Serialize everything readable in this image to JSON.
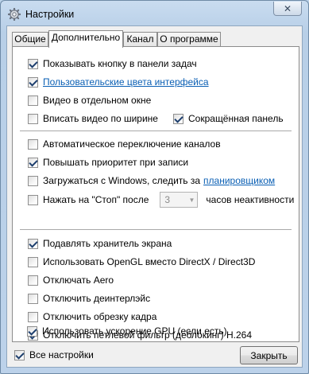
{
  "window": {
    "title": "Настройки",
    "close_glyph": "✕"
  },
  "tabs": [
    {
      "label": "Общие",
      "active": false
    },
    {
      "label": "Дополнительно",
      "active": true
    },
    {
      "label": "Канал",
      "active": false
    },
    {
      "label": "О программе",
      "active": false
    }
  ],
  "options": {
    "show_taskbar_button": {
      "label": "Показывать кнопку в панели задач",
      "checked": true
    },
    "custom_colors": {
      "label": "Пользовательские цвета интерфейса",
      "checked": true
    },
    "video_separate_window": {
      "label": "Видео в отдельном окне",
      "checked": false
    },
    "fit_video_width": {
      "label": "Вписать видео по ширине",
      "checked": false
    },
    "compact_panel": {
      "label": "Сокращённая панель",
      "checked": true
    },
    "auto_switch_channels": {
      "label": "Автоматическое переключение каналов",
      "checked": false
    },
    "raise_priority": {
      "label": "Повышать приоритет при записи",
      "checked": true
    },
    "load_with_windows": {
      "label": "Загружаться с Windows, следить за",
      "link": "планировщиком",
      "checked": false
    },
    "stop_after": {
      "label_before": "Нажать на \"Стоп\" после",
      "value": "3",
      "label_after": "часов неактивности",
      "checked": false
    },
    "suppress_screensaver": {
      "label": "Подавлять хранитель экрана",
      "checked": true
    },
    "use_opengl": {
      "label": "Использовать OpenGL вместо DirectX / Direct3D",
      "checked": false
    },
    "disable_aero": {
      "label": "Отключать Aero",
      "checked": false
    },
    "disable_deinterlace": {
      "label": "Отключить деинтерлэйс",
      "checked": false
    },
    "disable_crop": {
      "label": "Отключить обрезку кадра",
      "checked": false
    },
    "disable_loop_filter": {
      "label": "Отключить петлевой фильтр (деблокинг) H.264",
      "checked": true
    },
    "use_gpu": {
      "label": "Использовать ускорение GPU (если есть)",
      "checked": true
    }
  },
  "footer": {
    "all_settings": {
      "label": "Все настройки",
      "checked": true
    },
    "close_button": "Закрыть"
  }
}
